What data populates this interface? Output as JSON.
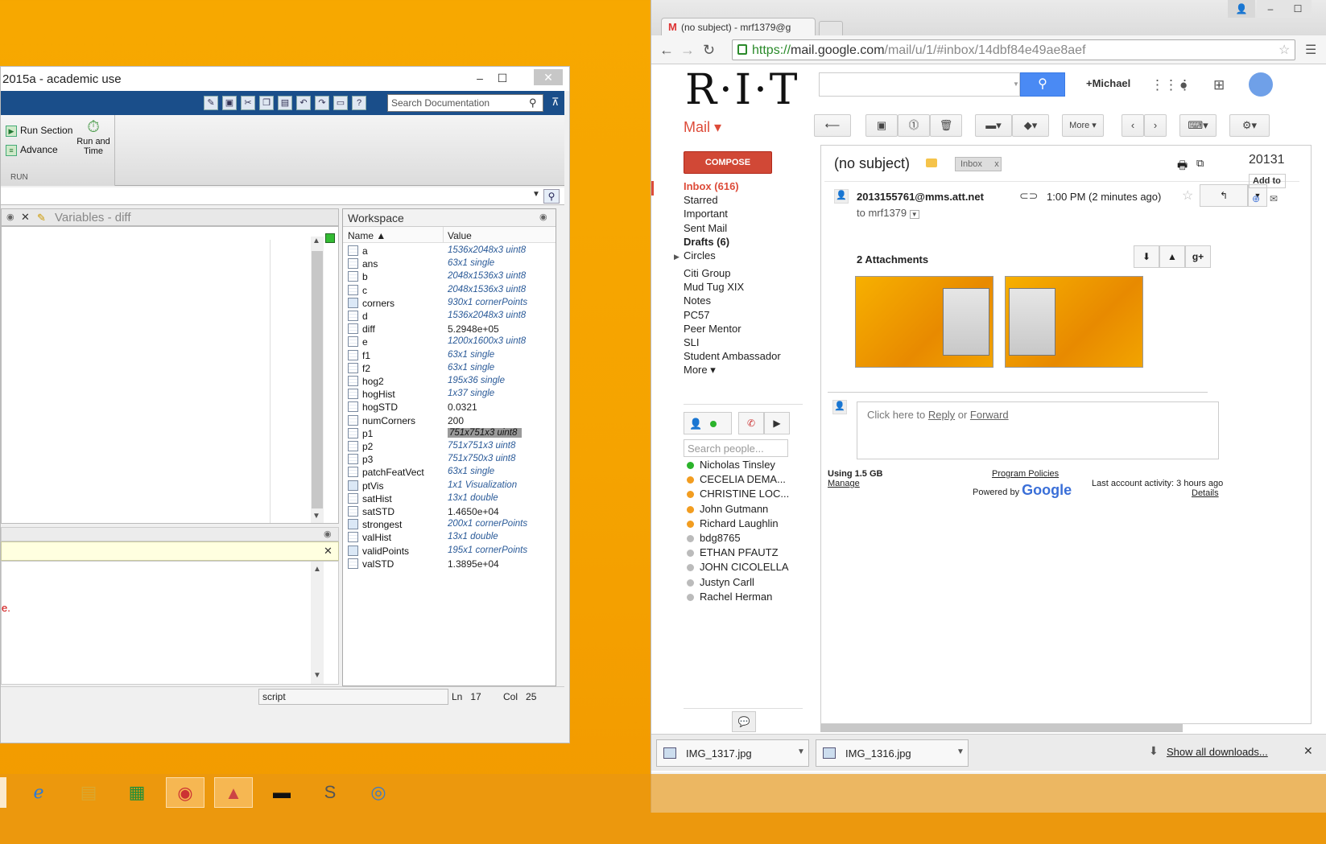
{
  "matlab": {
    "title": "2015a - academic use",
    "search_placeholder": "Search Documentation",
    "ribbon": {
      "run_section": "Run Section",
      "advance": "Advance",
      "run_and_time": "Run and\nTime",
      "group_label": "RUN"
    },
    "variables_tab": "Variables - diff",
    "workspace": {
      "title": "Workspace",
      "col_name": "Name ▲",
      "col_value": "Value",
      "rows": [
        {
          "name": "a",
          "value": "1536x2048x3 uint8"
        },
        {
          "name": "ans",
          "value": "63x1 single"
        },
        {
          "name": "b",
          "value": "2048x1536x3 uint8"
        },
        {
          "name": "c",
          "value": "2048x1536x3 uint8"
        },
        {
          "name": "corners",
          "value": "930x1 cornerPoints"
        },
        {
          "name": "d",
          "value": "1536x2048x3 uint8"
        },
        {
          "name": "diff",
          "value": "5.2948e+05"
        },
        {
          "name": "e",
          "value": "1200x1600x3 uint8"
        },
        {
          "name": "f1",
          "value": "63x1 single"
        },
        {
          "name": "f2",
          "value": "63x1 single"
        },
        {
          "name": "hog2",
          "value": "195x36 single"
        },
        {
          "name": "hogHist",
          "value": "1x37 single"
        },
        {
          "name": "hogSTD",
          "value": "0.0321"
        },
        {
          "name": "numCorners",
          "value": "200"
        },
        {
          "name": "p1",
          "value": "751x751x3 uint8"
        },
        {
          "name": "p2",
          "value": "751x751x3 uint8"
        },
        {
          "name": "p3",
          "value": "751x750x3 uint8"
        },
        {
          "name": "patchFeatVect",
          "value": "63x1 single"
        },
        {
          "name": "ptVis",
          "value": "1x1 Visualization"
        },
        {
          "name": "satHist",
          "value": "13x1 double"
        },
        {
          "name": "satSTD",
          "value": "1.4650e+04"
        },
        {
          "name": "strongest",
          "value": "200x1 cornerPoints"
        },
        {
          "name": "valHist",
          "value": "13x1 double"
        },
        {
          "name": "validPoints",
          "value": "195x1 cornerPoints"
        },
        {
          "name": "valSTD",
          "value": "1.3895e+04"
        }
      ]
    },
    "cmd_error_fragment": "e.",
    "status": {
      "mode": "script",
      "ln_label": "Ln",
      "ln": "17",
      "col_label": "Col",
      "col": "25"
    }
  },
  "chrome": {
    "tab_title": "(no subject) - mrf1379@g",
    "url_scheme": "https://",
    "url_host": "mail.google.com",
    "url_path": "/mail/u/1/#inbox/14dbf84e49ae8aef",
    "downloads": [
      "IMG_1317.jpg",
      "IMG_1316.jpg"
    ],
    "show_all_downloads": "Show all downloads..."
  },
  "gmail": {
    "logo": "R·I·T",
    "user": "+Michael",
    "mail_label": "Mail ▾",
    "compose": "COMPOSE",
    "more_btn": "More ▾",
    "nav": [
      {
        "label": "Inbox (616)",
        "style": "red"
      },
      {
        "label": "Starred",
        "style": ""
      },
      {
        "label": "Important",
        "style": ""
      },
      {
        "label": "Sent Mail",
        "style": ""
      },
      {
        "label": "Drafts (6)",
        "style": "b"
      },
      {
        "label": "Circles",
        "style": ""
      }
    ],
    "labels": [
      "Citi Group",
      "Mud Tug XIX",
      "Notes",
      "PC57",
      "Peer Mentor",
      "SLI",
      "Student Ambassador",
      "More ▾"
    ],
    "people_placeholder": "Search people...",
    "contacts": [
      {
        "name": "Nicholas Tinsley",
        "status": "#2bb32b"
      },
      {
        "name": "CECELIA DEMA...",
        "status": "#f29d20"
      },
      {
        "name": "CHRISTINE LOC...",
        "status": "#f29d20"
      },
      {
        "name": "John Gutmann",
        "status": "#f29d20"
      },
      {
        "name": "Richard Laughlin",
        "status": "#f29d20"
      },
      {
        "name": "bdg8765",
        "status": "#bbbbbb"
      },
      {
        "name": "ETHAN PFAUTZ",
        "status": "#bbbbbb"
      },
      {
        "name": "JOHN CICOLELLA",
        "status": "#bbbbbb"
      },
      {
        "name": "Justyn Carll",
        "status": "#bbbbbb"
      },
      {
        "name": "Rachel Herman",
        "status": "#bbbbbb"
      }
    ],
    "message": {
      "subject": "(no subject)",
      "label_chip": "Inbox",
      "label_chip_close": "x",
      "sender": "2013155761@mms.att.net",
      "to": "to mrf1379",
      "time": "1:00 PM (2 minutes ago)",
      "attachments_title": "2 Attachments",
      "reply_prefix": "Click here to ",
      "reply_link": "Reply",
      "reply_or": " or ",
      "forward_link": "Forward"
    },
    "footer": {
      "usage": "Using 1.5 GB",
      "manage": "Manage",
      "policies": "Program Policies",
      "powered": "Powered by",
      "google": "Google",
      "activity": "Last account activity: 3 hours ago",
      "details": "Details"
    },
    "right_col": {
      "text": "20131",
      "add_to": "Add to"
    }
  },
  "colors": {
    "accent_red": "#dd4b39",
    "matlab_blue": "#1a4e8a",
    "desktop": "#f5a300"
  }
}
